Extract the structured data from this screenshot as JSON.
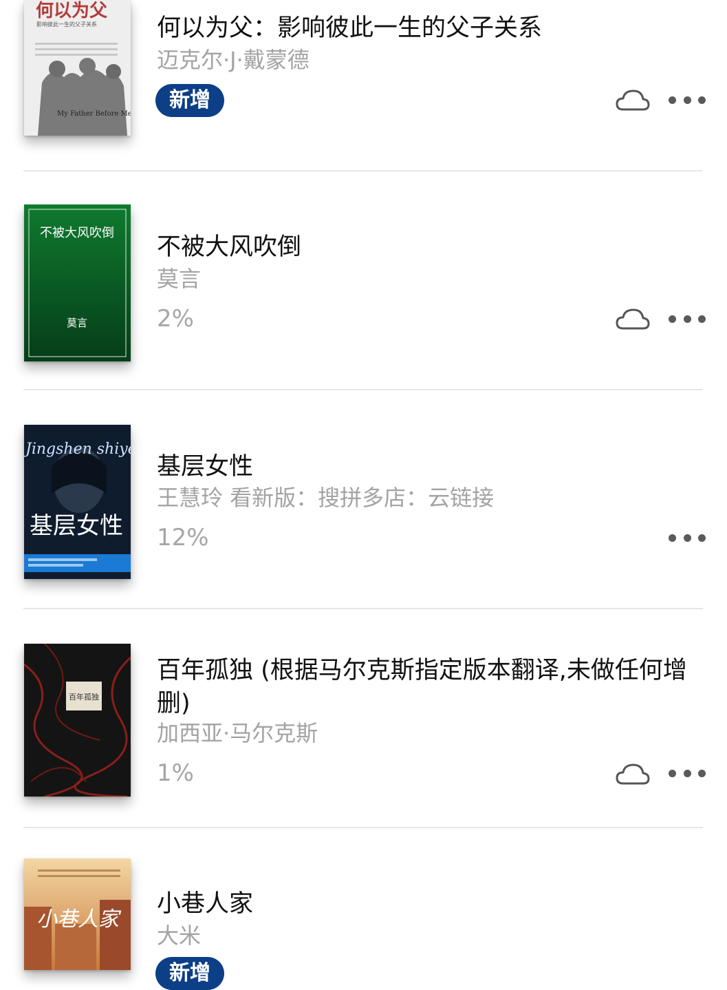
{
  "books": [
    {
      "title": "何以为父：影响彼此一生的父子关系",
      "author": "迈克尔·J·戴蒙德",
      "badge": "新增",
      "progress": "",
      "cover_text": {
        "title": "何以为父",
        "subtitle": "影响彼此一生的父子关系",
        "en": "My Father Before Me"
      }
    },
    {
      "title": "不被大风吹倒",
      "author": "莫言",
      "badge": "",
      "progress": "2%",
      "cover_text": {
        "title": "不被大风吹倒",
        "author": "莫言"
      }
    },
    {
      "title": "基层女性",
      "author": "王慧玲 看新版：搜拼多店：云链接",
      "badge": "",
      "progress": "12%",
      "cover_text": {
        "title": "基层女性",
        "script": "Jingshen shiye De Jianli"
      }
    },
    {
      "title": "百年孤独 (根据马尔克斯指定版本翻译,未做任何增删)",
      "author": "加西亚·马尔克斯",
      "badge": "",
      "progress": "1%",
      "cover_text": {
        "title": "百年孤独"
      }
    },
    {
      "title": "小巷人家",
      "author": "大米",
      "badge": "新增",
      "progress": "",
      "cover_text": {
        "title": "小巷人家"
      }
    }
  ],
  "icons": {
    "cloud": "cloud-icon",
    "more": "more-icon"
  },
  "colors": {
    "badge_bg": "#0c3f86",
    "secondary_text": "#a3a3a3",
    "divider": "#e6e6e6"
  }
}
